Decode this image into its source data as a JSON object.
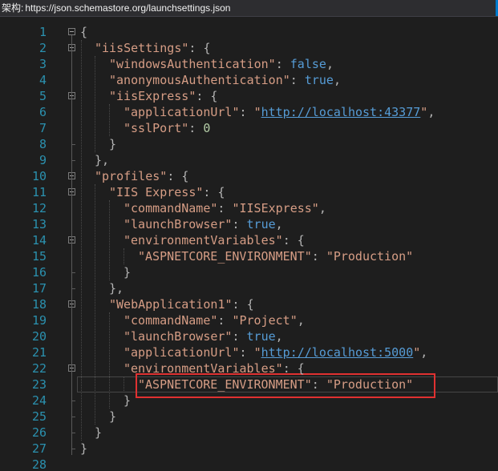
{
  "schema_bar": {
    "label": "架构:",
    "url": "https://json.schemastore.org/launchsettings.json"
  },
  "colors": {
    "background": "#1e1e1e",
    "line_number": "#2b91af",
    "string": "#d69d85",
    "keyword": "#569cd6",
    "punctuation": "#b4b4b4",
    "highlight_border": "#e03131"
  },
  "editor": {
    "lines": [
      {
        "n": "1",
        "parts": [
          [
            "p",
            "{"
          ]
        ]
      },
      {
        "n": "2",
        "parts": [
          [
            "s",
            "\"iisSettings\""
          ],
          [
            "p",
            ": {"
          ]
        ]
      },
      {
        "n": "3",
        "parts": [
          [
            "s",
            "\"windowsAuthentication\""
          ],
          [
            "p",
            ": "
          ],
          [
            "k",
            "false"
          ],
          [
            "p",
            ","
          ]
        ]
      },
      {
        "n": "4",
        "parts": [
          [
            "s",
            "\"anonymousAuthentication\""
          ],
          [
            "p",
            ": "
          ],
          [
            "k",
            "true"
          ],
          [
            "p",
            ","
          ]
        ]
      },
      {
        "n": "5",
        "parts": [
          [
            "s",
            "\"iisExpress\""
          ],
          [
            "p",
            ": {"
          ]
        ]
      },
      {
        "n": "6",
        "parts": [
          [
            "s",
            "\"applicationUrl\""
          ],
          [
            "p",
            ": "
          ],
          [
            "s",
            "\""
          ],
          [
            "u",
            "http://localhost:43377"
          ],
          [
            "s",
            "\""
          ],
          [
            "p",
            ","
          ]
        ]
      },
      {
        "n": "7",
        "parts": [
          [
            "s",
            "\"sslPort\""
          ],
          [
            "p",
            ": "
          ],
          [
            "n",
            "0"
          ]
        ]
      },
      {
        "n": "8",
        "parts": [
          [
            "p",
            "}"
          ]
        ]
      },
      {
        "n": "9",
        "parts": [
          [
            "p",
            "},"
          ]
        ]
      },
      {
        "n": "10",
        "parts": [
          [
            "s",
            "\"profiles\""
          ],
          [
            "p",
            ": {"
          ]
        ]
      },
      {
        "n": "11",
        "parts": [
          [
            "s",
            "\"IIS Express\""
          ],
          [
            "p",
            ": {"
          ]
        ]
      },
      {
        "n": "12",
        "parts": [
          [
            "s",
            "\"commandName\""
          ],
          [
            "p",
            ": "
          ],
          [
            "s",
            "\"IISExpress\""
          ],
          [
            "p",
            ","
          ]
        ]
      },
      {
        "n": "13",
        "parts": [
          [
            "s",
            "\"launchBrowser\""
          ],
          [
            "p",
            ": "
          ],
          [
            "k",
            "true"
          ],
          [
            "p",
            ","
          ]
        ]
      },
      {
        "n": "14",
        "parts": [
          [
            "s",
            "\"environmentVariables\""
          ],
          [
            "p",
            ": {"
          ]
        ]
      },
      {
        "n": "15",
        "parts": [
          [
            "s",
            "\"ASPNETCORE_ENVIRONMENT\""
          ],
          [
            "p",
            ": "
          ],
          [
            "s",
            "\"Production\""
          ]
        ]
      },
      {
        "n": "16",
        "parts": [
          [
            "p",
            "}"
          ]
        ]
      },
      {
        "n": "17",
        "parts": [
          [
            "p",
            "},"
          ]
        ]
      },
      {
        "n": "18",
        "parts": [
          [
            "s",
            "\"WebApplication1\""
          ],
          [
            "p",
            ": {"
          ]
        ]
      },
      {
        "n": "19",
        "parts": [
          [
            "s",
            "\"commandName\""
          ],
          [
            "p",
            ": "
          ],
          [
            "s",
            "\"Project\""
          ],
          [
            "p",
            ","
          ]
        ]
      },
      {
        "n": "20",
        "parts": [
          [
            "s",
            "\"launchBrowser\""
          ],
          [
            "p",
            ": "
          ],
          [
            "k",
            "true"
          ],
          [
            "p",
            ","
          ]
        ]
      },
      {
        "n": "21",
        "parts": [
          [
            "s",
            "\"applicationUrl\""
          ],
          [
            "p",
            ": "
          ],
          [
            "s",
            "\""
          ],
          [
            "u",
            "http://localhost:5000"
          ],
          [
            "s",
            "\""
          ],
          [
            "p",
            ","
          ]
        ]
      },
      {
        "n": "22",
        "parts": [
          [
            "s",
            "\"environmentVariables\""
          ],
          [
            "p",
            ": {"
          ]
        ]
      },
      {
        "n": "23",
        "parts": [
          [
            "s",
            "\"ASPNETCORE_ENVIRONMENT\""
          ],
          [
            "p",
            ": "
          ],
          [
            "s",
            "\"Production\""
          ]
        ]
      },
      {
        "n": "24",
        "parts": [
          [
            "p",
            "}"
          ]
        ]
      },
      {
        "n": "25",
        "parts": [
          [
            "p",
            "}"
          ]
        ]
      },
      {
        "n": "26",
        "parts": [
          [
            "p",
            "}"
          ]
        ]
      },
      {
        "n": "27",
        "parts": [
          [
            "p",
            "}"
          ]
        ]
      },
      {
        "n": "28",
        "parts": []
      }
    ]
  }
}
